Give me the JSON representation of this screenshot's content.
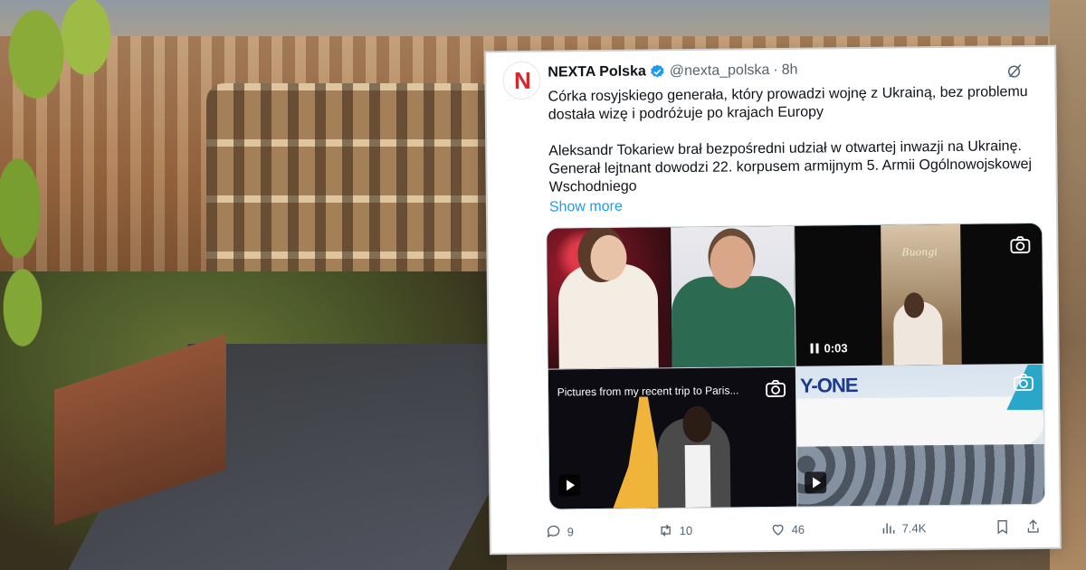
{
  "background": {
    "scene": "rome-colosseum-photo"
  },
  "tweet": {
    "display_name": "NEXTA Polska",
    "handle": "@nexta_polska",
    "separator": "·",
    "time": "8h",
    "verified": true,
    "avatar_logo": "N",
    "text_p1": "Córka rosyjskiego generała, który prowadzi wojnę z Ukrainą, bez problemu dostała wizę i podróżuje po krajach Europy",
    "text_p2": "Aleksandr Tokariew brał bezpośredni udział w otwartej inwazji na Ukrainę. Generał lejtnant dowodzi 22. korpusem armijnym 5. Armii Ogólnowojskowej Wschodniego",
    "show_more": "Show more",
    "media": {
      "video_duration": "0:03",
      "video_overlay_text": "Buongi",
      "photo_caption": "Pictures from my recent trip to Paris...",
      "plane_text": "Y-ONE"
    },
    "actions": {
      "replies": "9",
      "reposts": "10",
      "likes": "46",
      "views": "7.4K"
    },
    "colors": {
      "accent": "#1d9bf0",
      "text": "#0f1419",
      "muted": "#536471"
    }
  }
}
